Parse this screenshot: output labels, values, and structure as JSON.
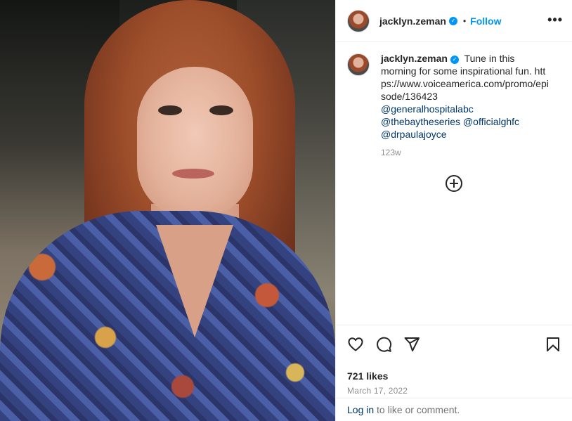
{
  "photo": {
    "subject": "photo"
  },
  "header": {
    "username": "jacklyn.zeman",
    "separator": "•",
    "follow_label": "Follow",
    "more_label": "•••"
  },
  "caption": {
    "username": "jacklyn.zeman",
    "text": "Tune in this morning for some inspirational fun.",
    "url": "https://www.voiceamerica.com/promo/episode/136423",
    "mentions": [
      "@generalhospitalabc",
      "@thebaytheseries",
      "@officialghfc",
      "@drpaulajoyce"
    ],
    "time": "123w"
  },
  "actions": {
    "icons": [
      "heart-icon",
      "comment-icon",
      "share-icon",
      "bookmark-icon"
    ],
    "likes": "721 likes",
    "date": "March 17, 2022"
  },
  "login": {
    "link": "Log in",
    "suffix": " to like or comment."
  },
  "colors": {
    "accent": "#0095f6",
    "link": "#00376b",
    "muted": "#8e8e8e",
    "text": "#262626"
  }
}
